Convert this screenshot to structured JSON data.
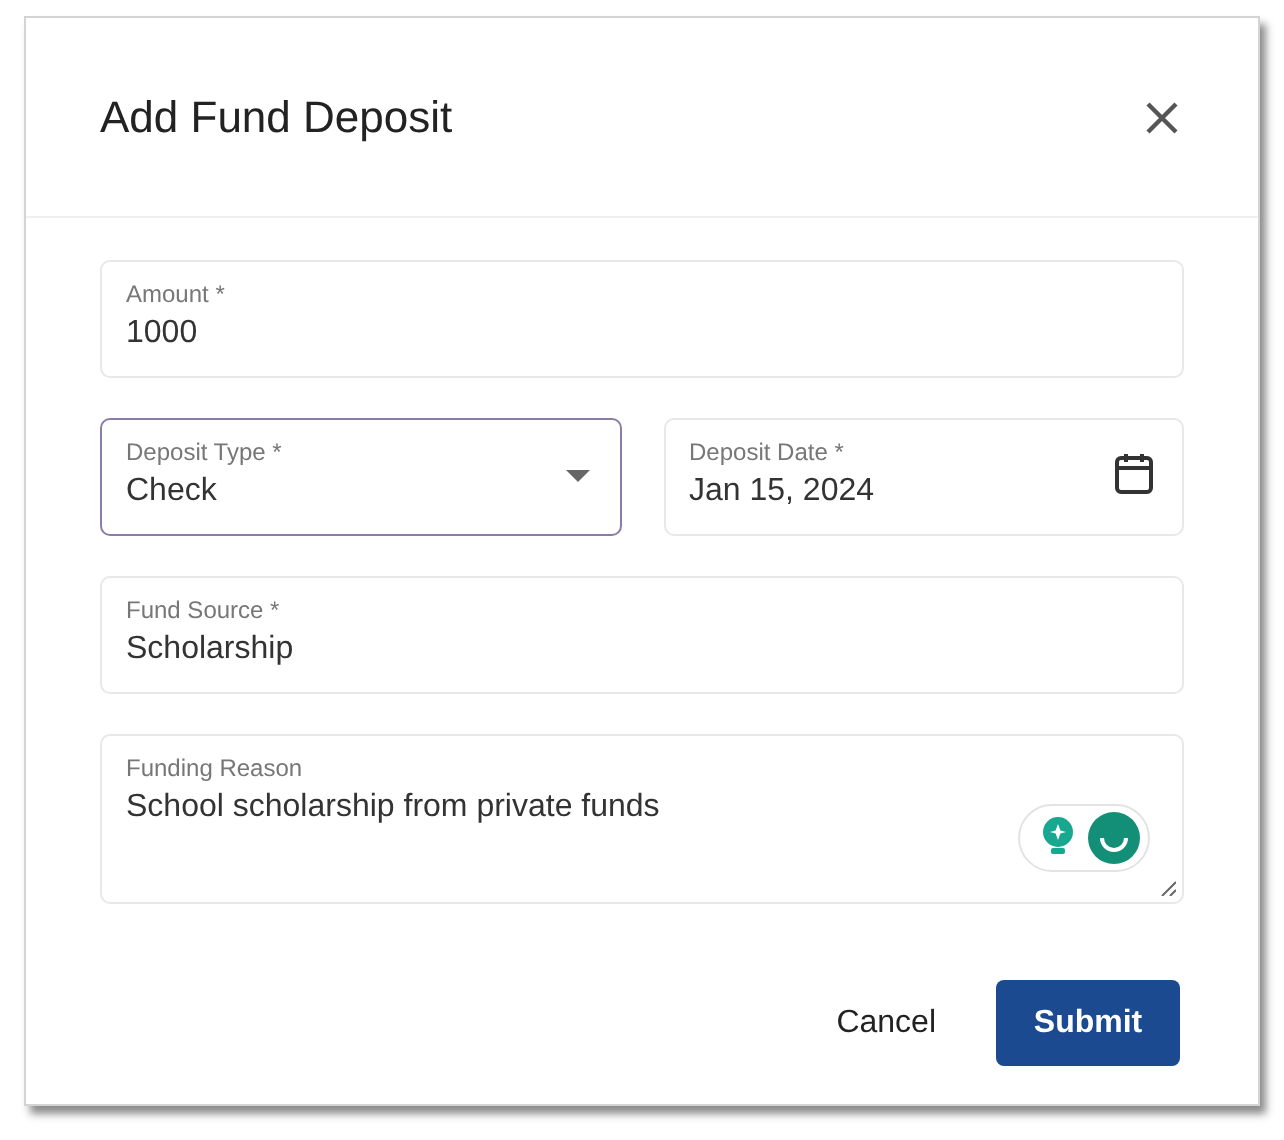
{
  "dialog": {
    "title": "Add Fund Deposit"
  },
  "rows": [
    [
      {
        "kind": "text",
        "label": "Amount *",
        "value": "1000",
        "focused": false
      }
    ],
    [
      {
        "kind": "select",
        "label": "Deposit Type *",
        "value": "Check",
        "focused": true
      },
      {
        "kind": "date",
        "label": "Deposit Date *",
        "value": "Jan 15, 2024",
        "focused": false
      }
    ],
    [
      {
        "kind": "text",
        "label": "Fund Source *",
        "value": "Scholarship",
        "focused": false
      }
    ],
    [
      {
        "kind": "textarea",
        "label": "Funding Reason",
        "value": "School scholarship from private funds",
        "focused": false
      }
    ]
  ],
  "buttons": [
    {
      "kind": "text",
      "label": "Cancel"
    },
    {
      "kind": "primary",
      "label": "Submit"
    }
  ]
}
